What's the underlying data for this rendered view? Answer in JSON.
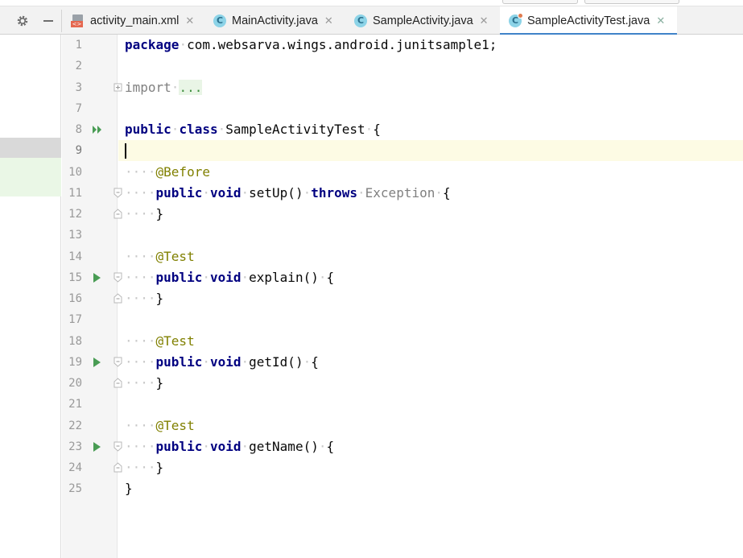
{
  "tabs": [
    {
      "label": "activity_main.xml",
      "icon": "xml-file-icon"
    },
    {
      "label": "MainActivity.java",
      "icon": "java-class-icon"
    },
    {
      "label": "SampleActivity.java",
      "icon": "java-class-icon"
    },
    {
      "label": "SampleActivityTest.java",
      "icon": "java-test-class-icon",
      "active": true
    }
  ],
  "toolbar": {
    "settings_icon": "gear-icon",
    "collapse_icon": "minus-icon"
  },
  "editor": {
    "lines": [
      {
        "num": "1"
      },
      {
        "num": "2"
      },
      {
        "num": "3"
      },
      {
        "num": "7"
      },
      {
        "num": "8"
      },
      {
        "num": "9"
      },
      {
        "num": "10"
      },
      {
        "num": "11"
      },
      {
        "num": "12"
      },
      {
        "num": "13"
      },
      {
        "num": "14"
      },
      {
        "num": "15"
      },
      {
        "num": "16"
      },
      {
        "num": "17"
      },
      {
        "num": "18"
      },
      {
        "num": "19"
      },
      {
        "num": "20"
      },
      {
        "num": "21"
      },
      {
        "num": "22"
      },
      {
        "num": "23"
      },
      {
        "num": "24"
      },
      {
        "num": "25"
      }
    ],
    "code": {
      "package_kw": "package",
      "package_name": "com.websarva.wings.android.junitsample1;",
      "import_kw": "import",
      "import_fold": "...",
      "public_kw": "public",
      "class_kw": "class",
      "class_name": "SampleActivityTest",
      "open_brace": "{",
      "close_brace": "}",
      "before_annotation": "@Before",
      "test_annotation": "@Test",
      "void_kw": "void",
      "setup_sig": "setUp()",
      "throws_kw": "throws",
      "exception": "Exception",
      "explain_sig": "explain()",
      "getid_sig": "getId()",
      "getname_sig": "getName()"
    }
  },
  "colors": {
    "keyword": "#000080",
    "annotation": "#808000",
    "run_icon": "#499c54",
    "tab_underline": "#4083c9",
    "current_line": "#fdfbe4"
  }
}
